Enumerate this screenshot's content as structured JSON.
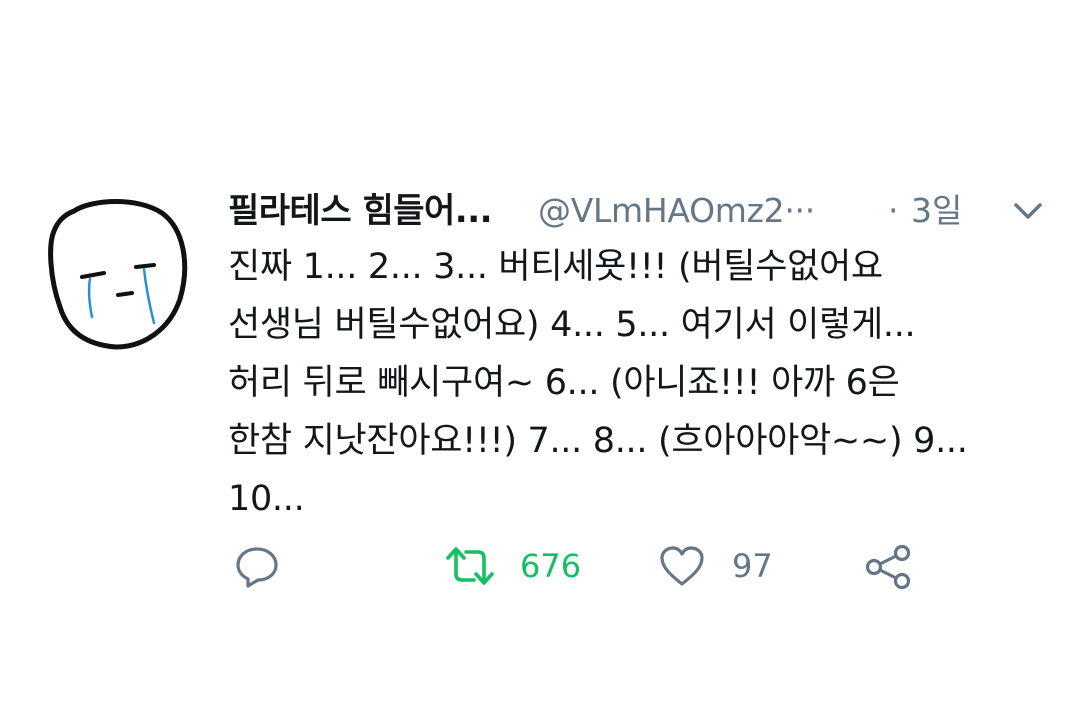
{
  "tweet": {
    "display_name": "필라테스 힘들어...",
    "handle": "@VLmHAOmz2···",
    "separator": "·",
    "timestamp": "3일",
    "body_lines": [
      "진짜 1... 2... 3... 버티세욧!!! (버틸수없어요",
      "선생님 버틸수없어요) 4... 5... 여기서 이렇게...",
      "허리 뒤로 빼시구여~ 6... (아니죠!!! 아까 6은",
      "한참 지낫잔아요!!!) 7... 8... (흐아아아악~~) 9...",
      "10..."
    ]
  },
  "actions": {
    "reply_icon": "reply-icon",
    "retweet_icon": "retweet-icon",
    "retweet_count": "676",
    "like_icon": "heart-icon",
    "like_count": "97",
    "share_icon": "share-icon"
  },
  "colors": {
    "name": "#14171a",
    "secondary": "#657786",
    "retweet_active": "#17bf63",
    "background": "#ffffff"
  }
}
